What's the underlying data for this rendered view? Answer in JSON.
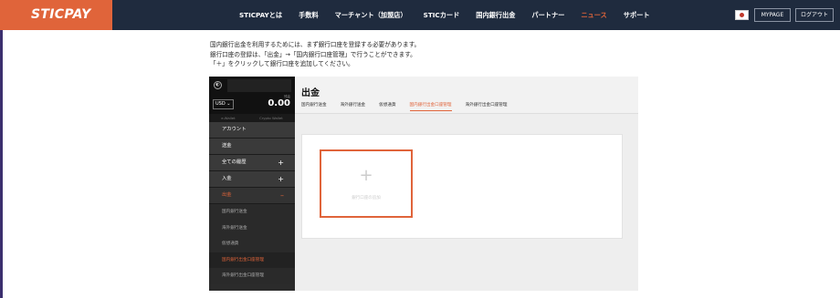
{
  "header": {
    "logo": "STICPAY",
    "nav": [
      {
        "label": "STICPAYとは",
        "active": false
      },
      {
        "label": "手数料",
        "active": false
      },
      {
        "label": "マーチャント（加盟店）",
        "active": false
      },
      {
        "label": "STICカード",
        "active": false
      },
      {
        "label": "国内銀行出金",
        "active": false
      },
      {
        "label": "パートナー",
        "active": false
      },
      {
        "label": "ニュース",
        "active": true
      },
      {
        "label": "サポート",
        "active": false
      }
    ],
    "mypage": "MYPAGE",
    "logout": "ログアウト"
  },
  "instructions": [
    "国内銀行出金を利用するためには、まず銀行口座を登録する必要があります。",
    "銀行口座の登録は、「出金」→「国内銀行口座管理」で行うことができます。",
    "「＋」をクリックして銀行口座を追加してください。"
  ],
  "screenshot": {
    "sidebar": {
      "currency": "USD",
      "balance_label": "残高",
      "balance": "0.00",
      "wallet_tabs": [
        "e-Wallet",
        "Crypto Wallet"
      ],
      "menu": [
        {
          "label": "アカウント",
          "plus": false,
          "active": false
        },
        {
          "label": "送金",
          "plus": false,
          "active": false
        },
        {
          "label": "全ての履歴",
          "plus": true,
          "active": false
        },
        {
          "label": "入金",
          "plus": true,
          "active": false
        },
        {
          "label": "出金",
          "plus": true,
          "active": true
        }
      ],
      "submenu": [
        {
          "label": "国内銀行送金",
          "active": false
        },
        {
          "label": "海外銀行送金",
          "active": false
        },
        {
          "label": "仮想通貨",
          "active": false
        },
        {
          "label": "国内銀行出金口座管理",
          "active": true
        },
        {
          "label": "海外銀行出金口座管理",
          "active": false
        }
      ]
    },
    "main": {
      "title": "出金",
      "tabs": [
        {
          "label": "国内銀行送金",
          "active": false
        },
        {
          "label": "海外銀行送金",
          "active": false
        },
        {
          "label": "仮想通貨",
          "active": false
        },
        {
          "label": "国内銀行出金口座管理",
          "active": true
        },
        {
          "label": "海外銀行出金口座管理",
          "active": false
        }
      ],
      "add_label": "銀行口座の追加"
    }
  },
  "colors": {
    "accent": "#e0643a",
    "topbar": "#1f2b3e"
  }
}
